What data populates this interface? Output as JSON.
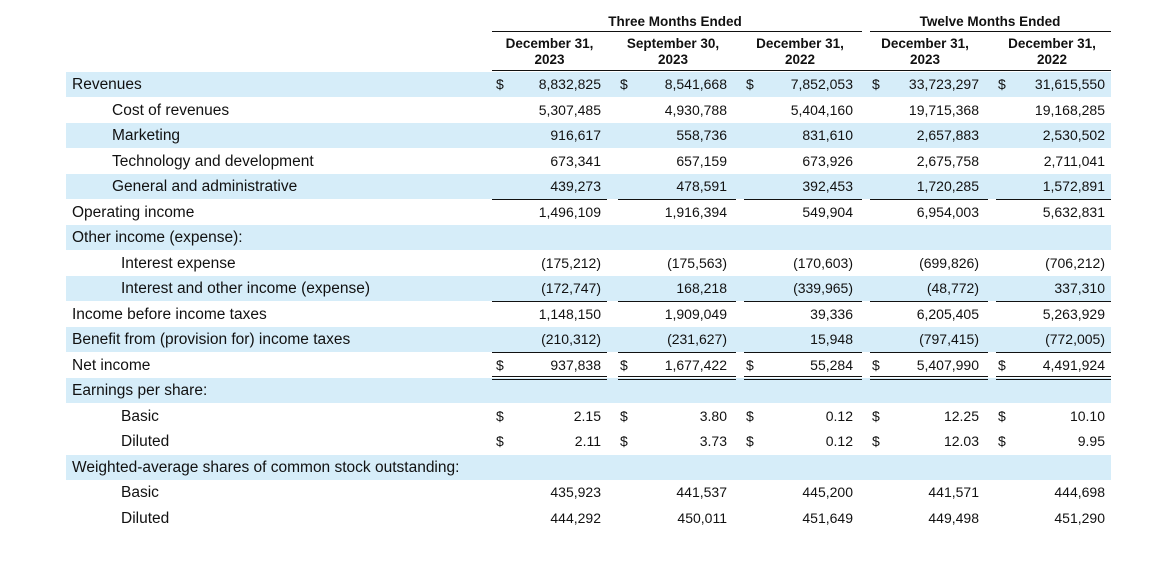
{
  "header": {
    "groups": [
      "Three Months Ended",
      "Twelve Months Ended"
    ],
    "columns": [
      [
        "December 31,",
        "2023"
      ],
      [
        "September 30,",
        "2023"
      ],
      [
        "December 31,",
        "2022"
      ],
      [
        "December 31,",
        "2023"
      ],
      [
        "December 31,",
        "2022"
      ]
    ]
  },
  "currency": "$",
  "rows": [
    {
      "label": "Revenues",
      "values": [
        "8,832,825",
        "8,541,668",
        "7,852,053",
        "33,723,297",
        "31,615,550"
      ]
    },
    {
      "label": "Cost of revenues",
      "values": [
        "5,307,485",
        "4,930,788",
        "5,404,160",
        "19,715,368",
        "19,168,285"
      ]
    },
    {
      "label": "Marketing",
      "values": [
        "916,617",
        "558,736",
        "831,610",
        "2,657,883",
        "2,530,502"
      ]
    },
    {
      "label": "Technology and development",
      "values": [
        "673,341",
        "657,159",
        "673,926",
        "2,675,758",
        "2,711,041"
      ]
    },
    {
      "label": "General and administrative",
      "values": [
        "439,273",
        "478,591",
        "392,453",
        "1,720,285",
        "1,572,891"
      ]
    },
    {
      "label": "Operating income",
      "values": [
        "1,496,109",
        "1,916,394",
        "549,904",
        "6,954,003",
        "5,632,831"
      ]
    },
    {
      "label": "Other income (expense):",
      "values": [
        "",
        "",
        "",
        "",
        ""
      ]
    },
    {
      "label": "Interest expense",
      "values": [
        "(175,212)",
        "(175,563)",
        "(170,603)",
        "(699,826)",
        "(706,212)"
      ]
    },
    {
      "label": "Interest and other income (expense)",
      "values": [
        "(172,747)",
        "168,218",
        "(339,965)",
        "(48,772)",
        "337,310"
      ]
    },
    {
      "label": "Income before income taxes",
      "values": [
        "1,148,150",
        "1,909,049",
        "39,336",
        "6,205,405",
        "5,263,929"
      ]
    },
    {
      "label": "Benefit from (provision for) income taxes",
      "values": [
        "(210,312)",
        "(231,627)",
        "15,948",
        "(797,415)",
        "(772,005)"
      ]
    },
    {
      "label": "Net income",
      "values": [
        "937,838",
        "1,677,422",
        "55,284",
        "5,407,990",
        "4,491,924"
      ]
    },
    {
      "label": "Earnings per share:",
      "values": [
        "",
        "",
        "",
        "",
        ""
      ]
    },
    {
      "label": "Basic",
      "values": [
        "2.15",
        "3.80",
        "0.12",
        "12.25",
        "10.10"
      ]
    },
    {
      "label": "Diluted",
      "values": [
        "2.11",
        "3.73",
        "0.12",
        "12.03",
        "9.95"
      ]
    },
    {
      "label": "Weighted-average shares of common stock outstanding:",
      "values": [
        "",
        "",
        "",
        "",
        ""
      ]
    },
    {
      "label": "Basic",
      "values": [
        "435,923",
        "441,537",
        "445,200",
        "441,571",
        "444,698"
      ]
    },
    {
      "label": "Diluted",
      "values": [
        "444,292",
        "450,011",
        "451,649",
        "449,498",
        "451,290"
      ]
    }
  ]
}
